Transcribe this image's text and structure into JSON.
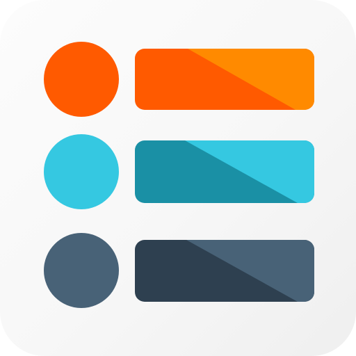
{
  "app_icon": {
    "name": "checklist-icon",
    "background_color": "#f7f7f7",
    "rows": [
      {
        "name": "orange",
        "dot_color": "#ff5a00",
        "bar_color_dark": "#ff5a00",
        "bar_color_light": "#ff8a00"
      },
      {
        "name": "teal",
        "dot_color": "#35c8e1",
        "bar_color_dark": "#1a90a5",
        "bar_color_light": "#35c8e1"
      },
      {
        "name": "slate",
        "dot_color": "#486277",
        "bar_color_dark": "#2e4050",
        "bar_color_light": "#486277"
      }
    ]
  }
}
